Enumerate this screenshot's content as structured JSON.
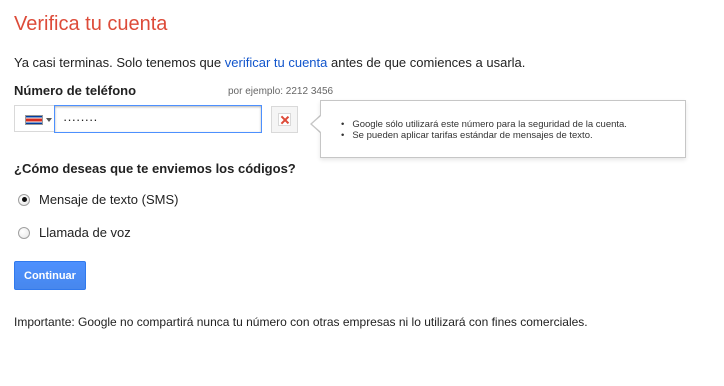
{
  "title": "Verifica tu cuenta",
  "intro": {
    "before": "Ya casi terminas. Solo tenemos que ",
    "link": "verificar tu cuenta",
    "after": " antes de que comiences a usarla."
  },
  "phone": {
    "label": "Número de teléfono",
    "hint": "por ejemplo: 2212 3456",
    "country_flag": "flag-icon",
    "value": "········"
  },
  "tooltip": {
    "items": [
      "Google sólo utilizará este número para la seguridad de la cuenta.",
      "Se pueden aplicar tarifas estándar de mensajes de texto."
    ]
  },
  "delivery": {
    "question": "¿Cómo deseas que te enviemos los códigos?",
    "options": [
      {
        "label": "Mensaje de texto (SMS)",
        "selected": true
      },
      {
        "label": "Llamada de voz",
        "selected": false
      }
    ]
  },
  "continue_label": "Continuar",
  "footer_note": "Importante: Google no compartirá nunca tu número con otras empresas ni lo utilizará con fines comerciales.",
  "colors": {
    "title": "#dd4b39",
    "link": "#1155cc",
    "button": "#4d90fe",
    "input_focus_border": "#4d90fe",
    "error_x": "#dd4b39"
  }
}
